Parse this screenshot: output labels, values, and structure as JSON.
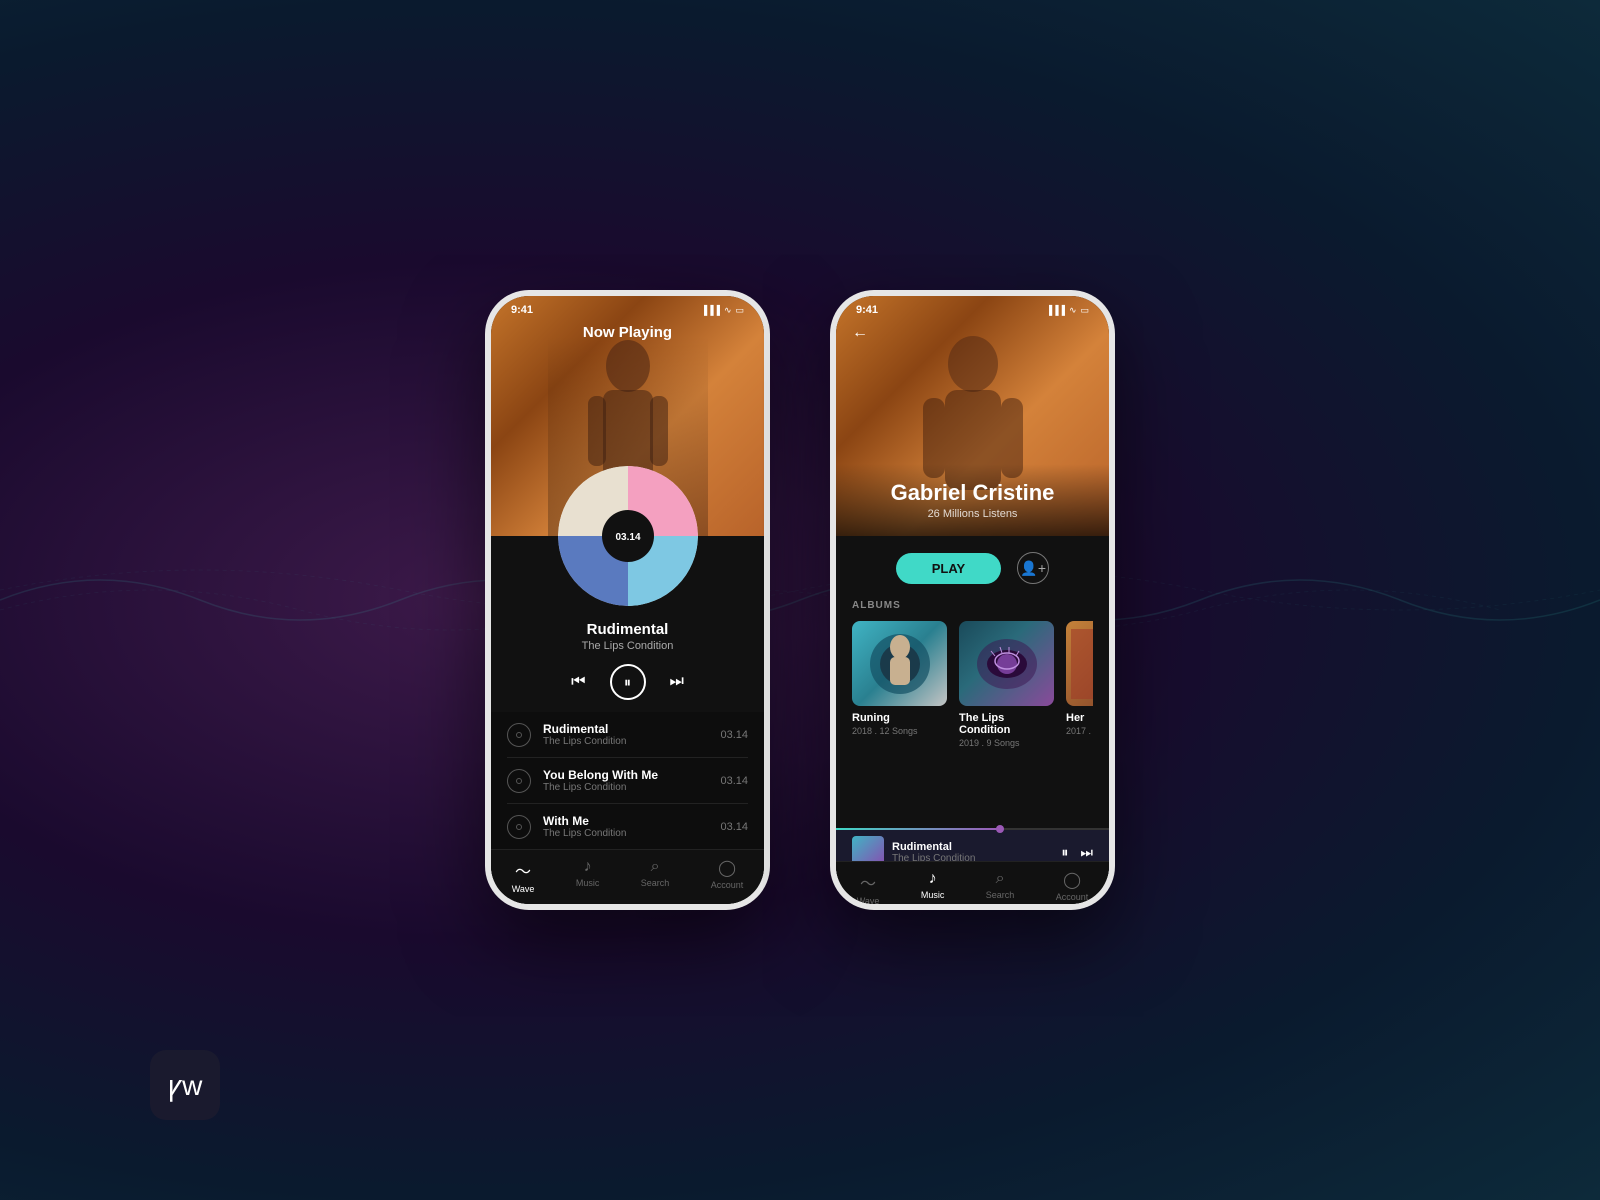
{
  "background": {
    "gradient": "radial from purple-dark to dark-teal"
  },
  "phone1": {
    "status_bar": {
      "time": "9:41",
      "icons": "signal wifi battery"
    },
    "header": {
      "label": "Now Playing"
    },
    "vinyl": {
      "time": "03.14"
    },
    "track": {
      "name": "Rudimental",
      "album": "The Lips Condition"
    },
    "playlist": [
      {
        "song": "Rudimental",
        "album": "The Lips Condition",
        "duration": "03.14"
      },
      {
        "song": "You Belong With Me",
        "album": "The Lips Condition",
        "duration": "03.14"
      },
      {
        "song": "With Me",
        "album": "The Lips Condition",
        "duration": "03.14"
      }
    ],
    "nav": [
      {
        "label": "Wave",
        "icon": "〜",
        "active": true
      },
      {
        "label": "Music",
        "icon": "♪",
        "active": false
      },
      {
        "label": "Search",
        "icon": "⌕",
        "active": false
      },
      {
        "label": "Account",
        "icon": "◯",
        "active": false
      }
    ]
  },
  "phone2": {
    "status_bar": {
      "time": "9:41",
      "icons": "signal wifi battery"
    },
    "back_btn": "←",
    "artist": {
      "name": "Gabriel Cristine",
      "listens": "26 Millions Listens"
    },
    "play_btn": "PLAY",
    "albums_label": "ALBUMS",
    "albums": [
      {
        "title": "Runing",
        "meta": "2018 . 12 Songs"
      },
      {
        "title": "The Lips Condition",
        "meta": "2019 . 9 Songs"
      },
      {
        "title": "Her",
        "meta": "2017 ."
      }
    ],
    "mini_player": {
      "track": "Rudimental",
      "album": "The Lips Condition"
    },
    "nav": [
      {
        "label": "Wave",
        "icon": "〜",
        "active": false
      },
      {
        "label": "Music",
        "icon": "♪",
        "active": true
      },
      {
        "label": "Search",
        "icon": "⌕",
        "active": false
      },
      {
        "label": "Account",
        "icon": "◯",
        "active": false
      }
    ]
  },
  "logo": {
    "symbol": "ꝩw"
  }
}
